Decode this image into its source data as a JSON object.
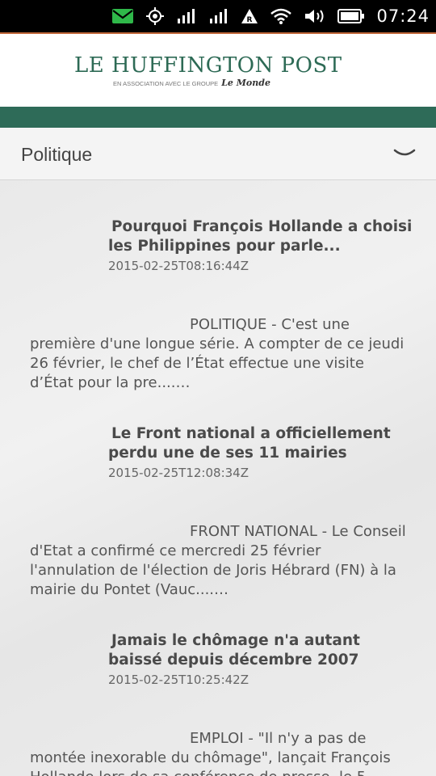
{
  "status_bar": {
    "time": "07:24",
    "icons": [
      "email-icon",
      "location-icon",
      "signal-icon",
      "signal-icon",
      "data-roaming-icon",
      "wifi-icon",
      "volume-icon",
      "battery-icon"
    ]
  },
  "header": {
    "title": "LE HUFFINGTON POST",
    "subtitle": "EN ASSOCIATION AVEC LE GROUPE",
    "partner": "Le Monde"
  },
  "category": {
    "selected": "Politique"
  },
  "articles": [
    {
      "title": "Pourquoi François Hollande a choisi les Philippines pour parle...",
      "date": "2015-02-25T08:16:44Z",
      "excerpt": "POLITIQUE - C'est une première d'une longue série. A compter de ce jeudi 26 février, le chef de l’État effectue une visite d’État pour la pre....…"
    },
    {
      "title": "Le Front national a officiellement perdu une de ses 11 mairies",
      "date": "2015-02-25T12:08:34Z",
      "excerpt": "FRONT NATIONAL - Le Conseil d'Etat a confirmé ce mercredi 25 février l'annulation de l'élection de Joris Hébrard (FN) à la mairie du Pontet (Vauc....…"
    },
    {
      "title": "Jamais le chômage n'a autant baissé depuis décembre 2007",
      "date": "2015-02-25T10:25:42Z",
      "excerpt": "EMPLOI - \"Il n'y a pas de montée inexorable du chômage\", lançait François Hollande lors de sa conférence de presse, le 5"
    }
  ],
  "colors": {
    "brand_green": "#2e6b58",
    "accent_orange": "#c1683a",
    "email_green": "#2fb84a"
  }
}
